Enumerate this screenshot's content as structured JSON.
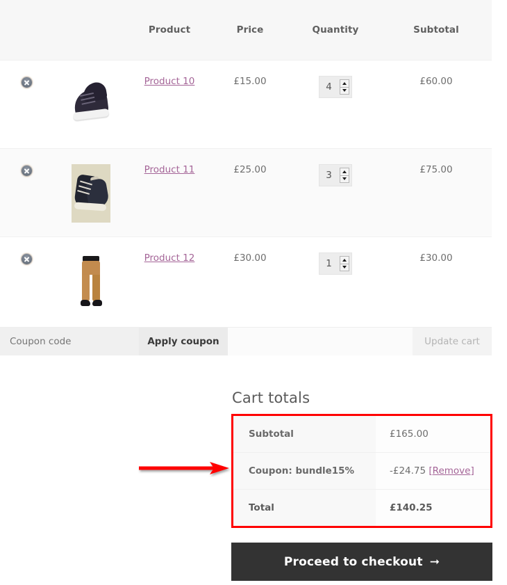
{
  "cart_table": {
    "columns": [
      "",
      "",
      "Product",
      "Price",
      "Quantity",
      "Subtotal"
    ],
    "headers": {
      "product": "Product",
      "price": "Price",
      "quantity": "Quantity",
      "subtotal": "Subtotal"
    },
    "rows": [
      {
        "remove_icon": "remove-circle-icon",
        "thumbnail": "dark-sneaker-photo",
        "name": "Product 10",
        "price": "£15.00",
        "quantity": "4",
        "subtotal": "£60.00"
      },
      {
        "remove_icon": "remove-circle-icon",
        "thumbnail": "canvas-hitop-sneaker-photo",
        "name": "Product 11",
        "price": "£25.00",
        "quantity": "3",
        "subtotal": "£75.00"
      },
      {
        "remove_icon": "remove-circle-icon",
        "thumbnail": "tan-trousers-photo",
        "name": "Product 12",
        "price": "£30.00",
        "quantity": "1",
        "subtotal": "£30.00"
      }
    ]
  },
  "actions": {
    "coupon_placeholder": "Coupon code",
    "coupon_value": "",
    "apply_coupon_label": "Apply coupon",
    "update_cart_label": "Update cart"
  },
  "cart_totals": {
    "heading": "Cart totals",
    "rows": [
      {
        "label": "Subtotal",
        "value": "£165.00",
        "link": ""
      },
      {
        "label": "Coupon: bundle15%",
        "value": "-£24.75",
        "link": "[Remove]"
      },
      {
        "label": "Total",
        "value": "£140.25",
        "link": ""
      }
    ]
  },
  "checkout": {
    "label": "Proceed to checkout",
    "arrow": "➜"
  },
  "annotation": {
    "arrow_icon": "red-arrow-pointing-right",
    "highlight_icon": "red-rectangle-highlight"
  },
  "colors": {
    "link": "#a46497",
    "annotation_red": "#ff0000",
    "checkout_bg": "#333333",
    "header_bg": "#f7f7f7",
    "row_alt_bg": "#fafafa"
  }
}
